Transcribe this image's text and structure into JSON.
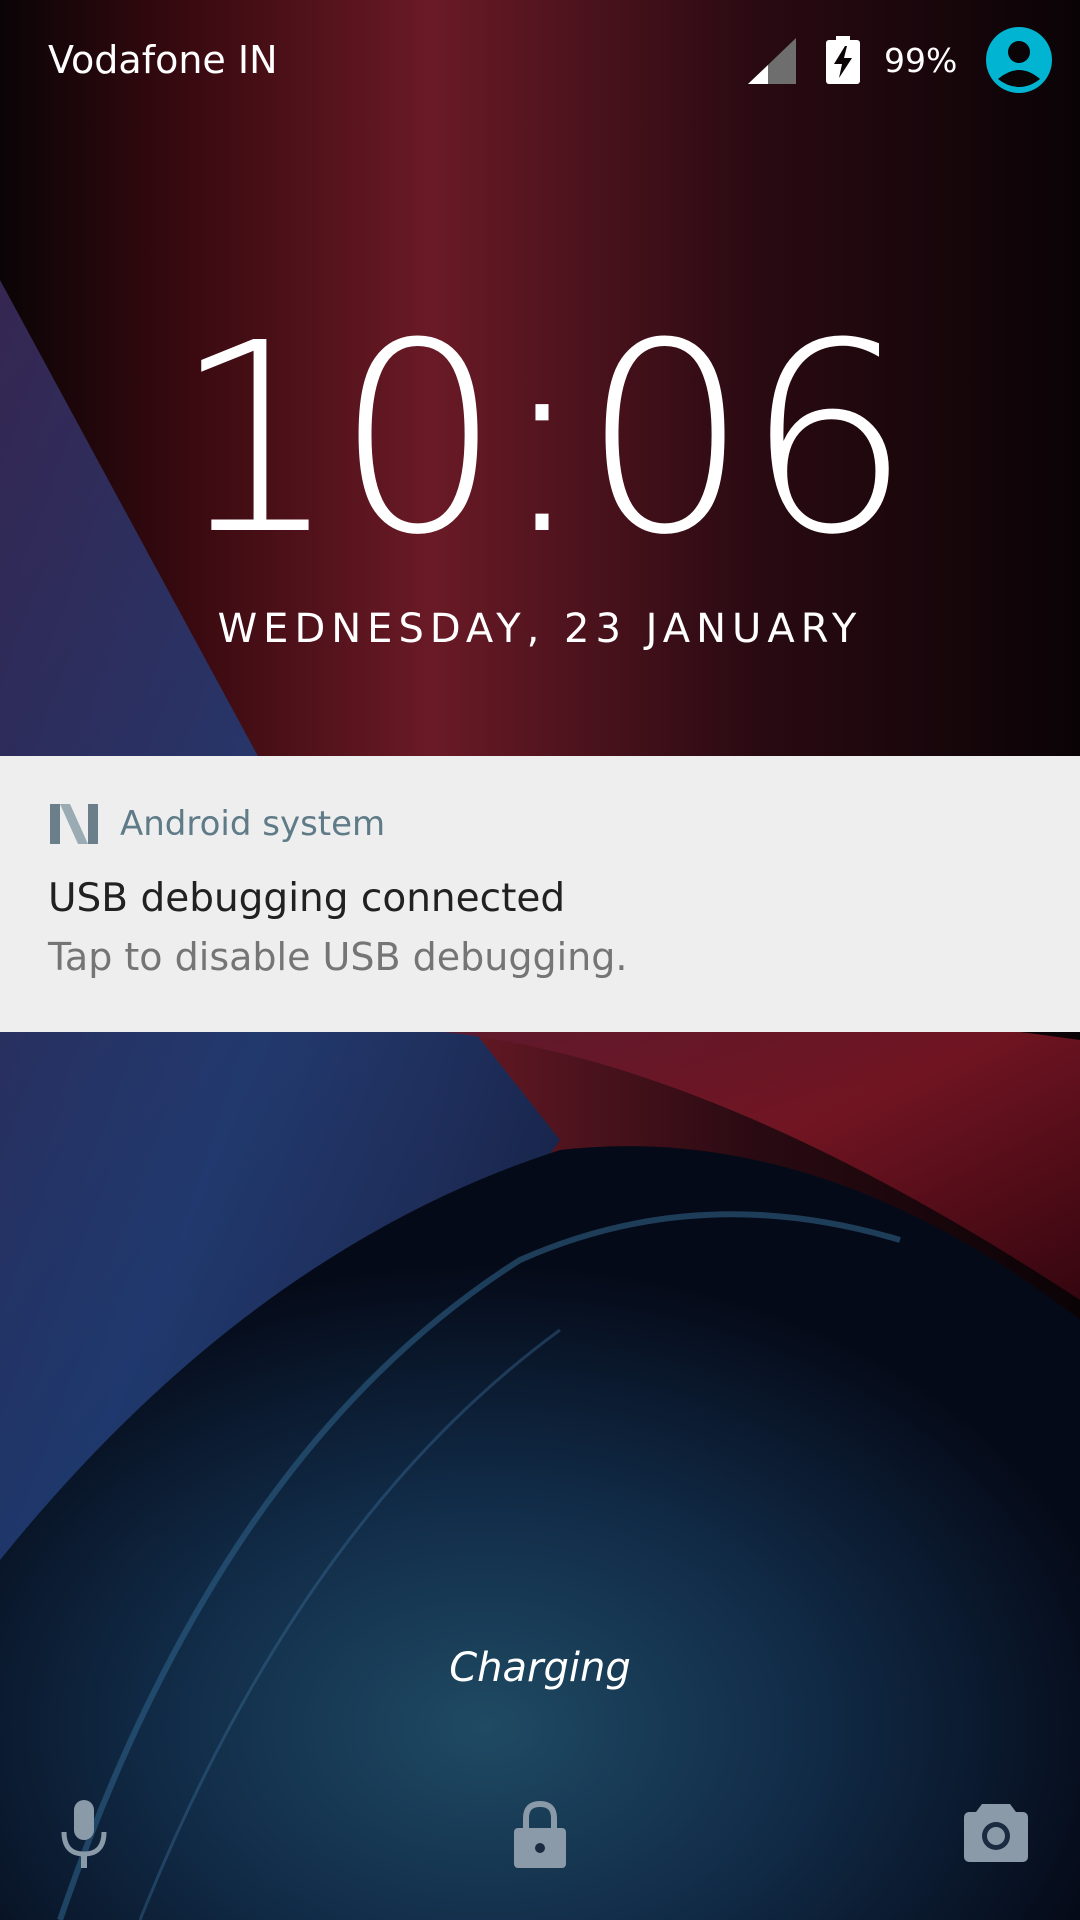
{
  "status_bar": {
    "carrier": "Vodafone IN",
    "battery_percent": "99%",
    "icons": [
      "signal-icon",
      "battery-charging-icon",
      "user-avatar-icon"
    ],
    "avatar_color": "#00b4d2"
  },
  "lockscreen": {
    "time": "10:06",
    "date": "WEDNESDAY, 23 JANUARY",
    "charging_text": "Charging"
  },
  "notification": {
    "app_name": "Android system",
    "title": "USB debugging connected",
    "text": "Tap to disable USB debugging.",
    "app_icon": "android-n-icon",
    "background": "#eeeeef",
    "app_name_color": "#5f7b87"
  },
  "bottom_actions": {
    "left": "microphone-icon",
    "center": "lock-icon",
    "right": "camera-icon"
  }
}
